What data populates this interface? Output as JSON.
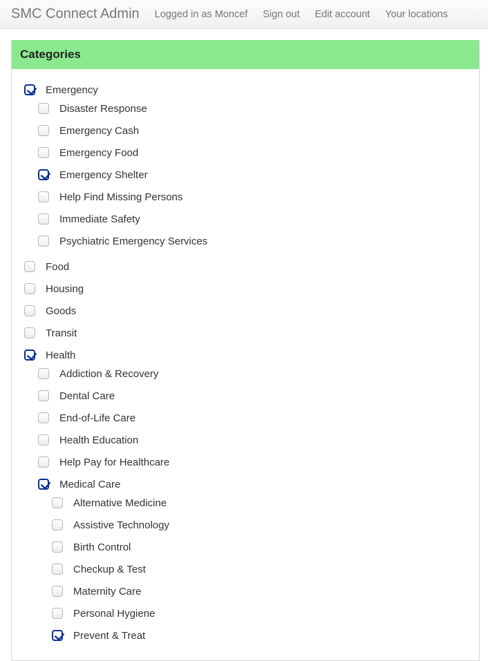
{
  "navbar": {
    "brand": "SMC Connect Admin",
    "links": [
      "Logged in as Moncef",
      "Sign out",
      "Edit account",
      "Your locations"
    ]
  },
  "panel": {
    "title": "Categories"
  },
  "categories": [
    {
      "label": "Emergency",
      "checked": true,
      "children": [
        {
          "label": "Disaster Response",
          "checked": false
        },
        {
          "label": "Emergency Cash",
          "checked": false
        },
        {
          "label": "Emergency Food",
          "checked": false
        },
        {
          "label": "Emergency Shelter",
          "checked": true
        },
        {
          "label": "Help Find Missing Persons",
          "checked": false
        },
        {
          "label": "Immediate Safety",
          "checked": false
        },
        {
          "label": "Psychiatric Emergency Services",
          "checked": false
        }
      ]
    },
    {
      "label": "Food",
      "checked": false
    },
    {
      "label": "Housing",
      "checked": false
    },
    {
      "label": "Goods",
      "checked": false
    },
    {
      "label": "Transit",
      "checked": false
    },
    {
      "label": "Health",
      "checked": true,
      "children": [
        {
          "label": "Addiction & Recovery",
          "checked": false
        },
        {
          "label": "Dental Care",
          "checked": false
        },
        {
          "label": "End-of-Life Care",
          "checked": false
        },
        {
          "label": "Health Education",
          "checked": false
        },
        {
          "label": "Help Pay for Healthcare",
          "checked": false
        },
        {
          "label": "Medical Care",
          "checked": true,
          "children": [
            {
              "label": "Alternative Medicine",
              "checked": false
            },
            {
              "label": "Assistive Technology",
              "checked": false
            },
            {
              "label": "Birth Control",
              "checked": false
            },
            {
              "label": "Checkup & Test",
              "checked": false
            },
            {
              "label": "Maternity Care",
              "checked": false
            },
            {
              "label": "Personal Hygiene",
              "checked": false
            },
            {
              "label": "Prevent & Treat",
              "checked": true
            }
          ]
        }
      ]
    }
  ]
}
